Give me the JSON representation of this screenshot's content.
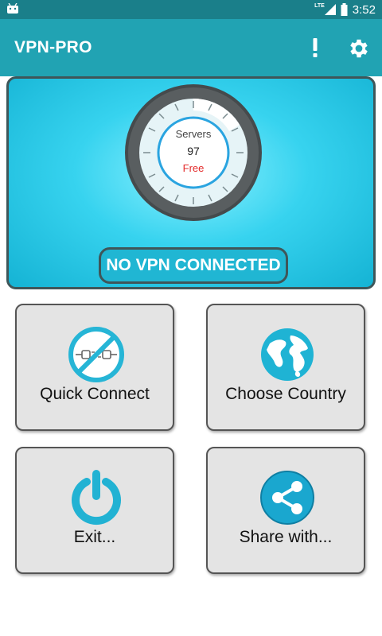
{
  "status_bar": {
    "time": "3:52",
    "network": "LTE"
  },
  "app_bar": {
    "title": "VPN-PRO"
  },
  "gauge": {
    "servers_label": "Servers",
    "server_count": "97",
    "tier": "Free"
  },
  "connection": {
    "status": "NO VPN CONNECTED"
  },
  "tiles": [
    {
      "label": "Quick Connect",
      "icon": "no-connection-icon"
    },
    {
      "label": "Choose Country",
      "icon": "globe-icon"
    },
    {
      "label": "Exit...",
      "icon": "power-icon"
    },
    {
      "label": "Share with...",
      "icon": "share-icon"
    }
  ],
  "colors": {
    "status_bar": "#1a7f8a",
    "app_bar": "#21a3b3",
    "accent": "#22b5d4",
    "tier_text": "#e32b2b"
  }
}
